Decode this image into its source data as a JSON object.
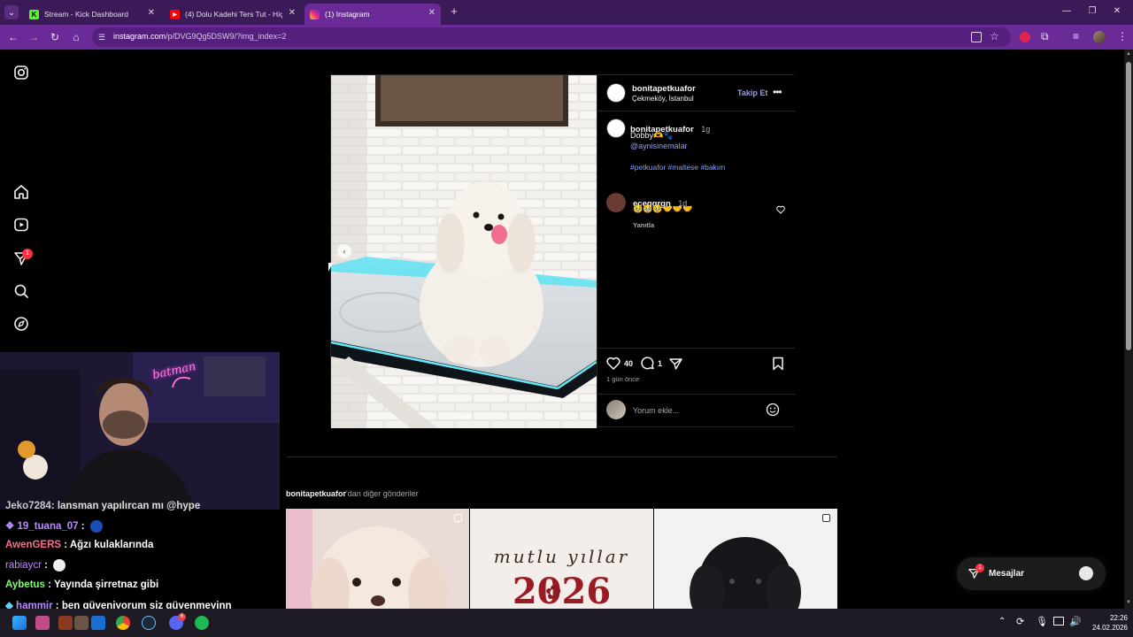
{
  "browser": {
    "tabs": [
      {
        "title": "Stream - Kick Dashboard",
        "icon": "kick-icon",
        "active": false
      },
      {
        "title": "(4) Dolu Kadehi Ters Tut - Hiç İyi Değilim",
        "icon": "youtube-icon",
        "active": false
      },
      {
        "title": "(1) Instagram",
        "icon": "instagram-icon",
        "active": true
      }
    ],
    "url_host": "instagram.com",
    "url_path": "/p/DVG9Qg5DSW9/?img_index=2"
  },
  "post": {
    "author": "bonitapetkuafor",
    "location": "Çekmeköy, İstanbul",
    "follow_label": "Takip Et",
    "caption": {
      "username": "bonitapetkuafor",
      "time": "1g",
      "text": "Dobby🫶🐾",
      "mention": "@aynisinemalar",
      "hashtags": "#petkuafor #maltese #bakım"
    },
    "comment": {
      "username": "eceggrgn",
      "time": "1d",
      "text": "🥹🥹🥹🤝🤝🤝",
      "reply_label": "Yanıtla"
    },
    "likes": "40",
    "comments_count": "1",
    "posted_ago": "1 gün önce",
    "add_comment_placeholder": "Yorum ekle...",
    "carousel": {
      "total": 2,
      "current": 2
    }
  },
  "more_posts": {
    "owner": "bonitapetkuafor",
    "suffix": "'dan diğer gönderiler"
  },
  "thumbnails": [
    {
      "name": "poodle-photo",
      "multi": true
    },
    {
      "name": "new-year-card",
      "text": "mutlu yıllar",
      "year": "2026",
      "multi": false
    },
    {
      "name": "black-poodle-photo",
      "multi": true
    }
  ],
  "sidebar": {
    "notification_count": "1",
    "items": [
      "instagram-logo-icon",
      "home-icon",
      "reels-icon",
      "messages-icon",
      "search-icon",
      "explore-icon"
    ]
  },
  "messages_widget": {
    "label": "Mesajlar",
    "badge": "1"
  },
  "chat": [
    {
      "user": "Jeko7284",
      "text": ": lansman yapılırcan mı @hype",
      "user_color": "#c8c8c8"
    },
    {
      "user": "19_tuana_07",
      "text": " :",
      "user_color": "#b98cff"
    },
    {
      "user": "AwenGERS",
      "text": " : Ağzı kulaklarında",
      "user_color": "#ff6b8b"
    },
    {
      "user": "rabiaycr",
      "text": " :",
      "user_color": "#b98cff"
    },
    {
      "user": "Aybetus",
      "text": " : Yayında şirretnaz gibi",
      "user_color": "#7cff6b"
    },
    {
      "user": "hammir",
      "text": " : ben güveniyorum siz güvenmeyinn",
      "user_color": "#b98cff"
    }
  ],
  "cam_sign": "batman",
  "taskbar": {
    "time": "22:26",
    "date": "24.02.2026",
    "discord_badge": "6"
  },
  "colors": {
    "browser_frame": "#3a1a57",
    "active_tab": "#6a2a98",
    "instagram_link": "#8c9eff",
    "notification": "#ff3040"
  }
}
